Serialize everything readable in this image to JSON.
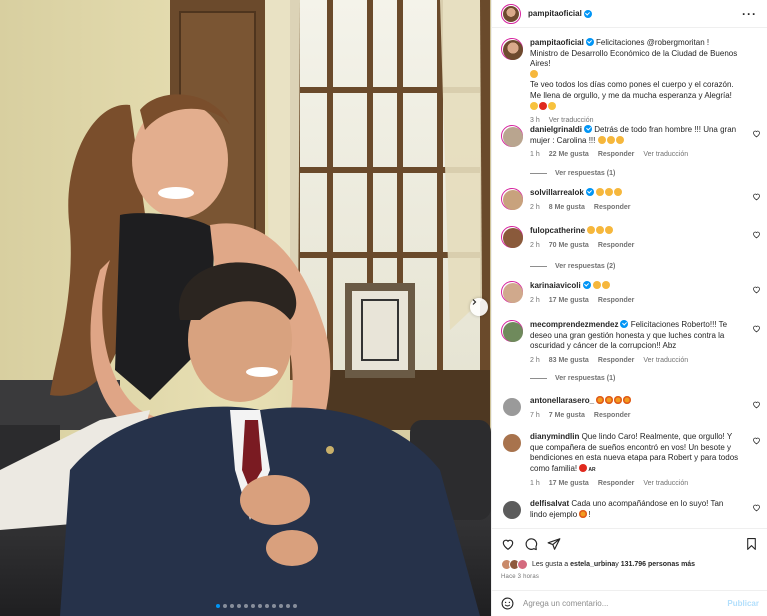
{
  "post": {
    "author": "pampitaoficial",
    "photo_count": 12,
    "active_photo": 1
  },
  "caption": {
    "author": "pampitaoficial",
    "lines": [
      "Felicitaciones @robergmoritan !",
      "Ministro de Desarrollo Económico de la Ciudad de Buenos Aires!",
      "Te veo todos los días como pones el cuerpo y el corazón.",
      "Me llena de orgullo, y me da mucha esperanza y Alegría!"
    ],
    "mention": "@robergmoritan",
    "time": "3 h",
    "translate": "Ver traducción"
  },
  "comments": [
    {
      "user": "danielgrinaldi",
      "verified": true,
      "text": "Detrás de todo fran hombre !!! Una gran mujer : Carolina !!!",
      "time": "1 h",
      "likes": "22 Me gusta",
      "reply": "Responder",
      "translate": "Ver traducción",
      "replies": "Ver respuestas (1)"
    },
    {
      "user": "solvillarrealok",
      "verified": true,
      "text": "",
      "time": "2 h",
      "likes": "8 Me gusta",
      "reply": "Responder"
    },
    {
      "user": "fulopcatherine",
      "verified": false,
      "text": "",
      "time": "2 h",
      "likes": "70 Me gusta",
      "reply": "Responder",
      "replies": "Ver respuestas (2)"
    },
    {
      "user": "karinaiavicoli",
      "verified": true,
      "text": "",
      "time": "2 h",
      "likes": "17 Me gusta",
      "reply": "Responder"
    },
    {
      "user": "mecomprendezmendez",
      "verified": true,
      "text": "Felicitaciones Roberto!!! Te deseo una gran gestión honesta y que luches contra la oscuridad y cáncer de la corrupcion!! Abz",
      "time": "2 h",
      "likes": "83 Me gusta",
      "reply": "Responder",
      "translate": "Ver traducción",
      "replies": "Ver respuestas (1)"
    },
    {
      "user": "antonellarasero_",
      "verified": false,
      "text": "",
      "time": "7 h",
      "likes": "7 Me gusta",
      "reply": "Responder"
    },
    {
      "user": "dianymindlin",
      "verified": false,
      "text": "Que lindo Caro! Realmente, que orgullo! Y que compañera de sueños encontró en vos! Un besote y bendiciones en esta nueva etapa para Robert y para todos como familia!",
      "tag": "AR",
      "time": "1 h",
      "likes": "17 Me gusta",
      "reply": "Responder",
      "translate": "Ver traducción"
    },
    {
      "user": "delfisalvat",
      "verified": false,
      "text": "Cada uno acompañándose en lo suyo! Tan lindo ejemplo",
      "time": "",
      "likes": "",
      "reply": ""
    }
  ],
  "likes_line": {
    "prefix": "Les gusta a ",
    "user": "estela_urbina",
    "middle": " y ",
    "count": "131.796 personas más"
  },
  "posted_ago": "Hace 3 horas",
  "add_comment": {
    "placeholder": "Agrega un comentario...",
    "publish": "Publicar"
  },
  "colors": {
    "verified": "#0095f6",
    "meta_text": "#737373",
    "publish_disabled": "#b2dffc"
  },
  "icons": [
    "more-icon",
    "heart-icon",
    "comment-icon",
    "share-icon",
    "bookmark-icon",
    "emoji-icon",
    "chevron-right-icon"
  ]
}
